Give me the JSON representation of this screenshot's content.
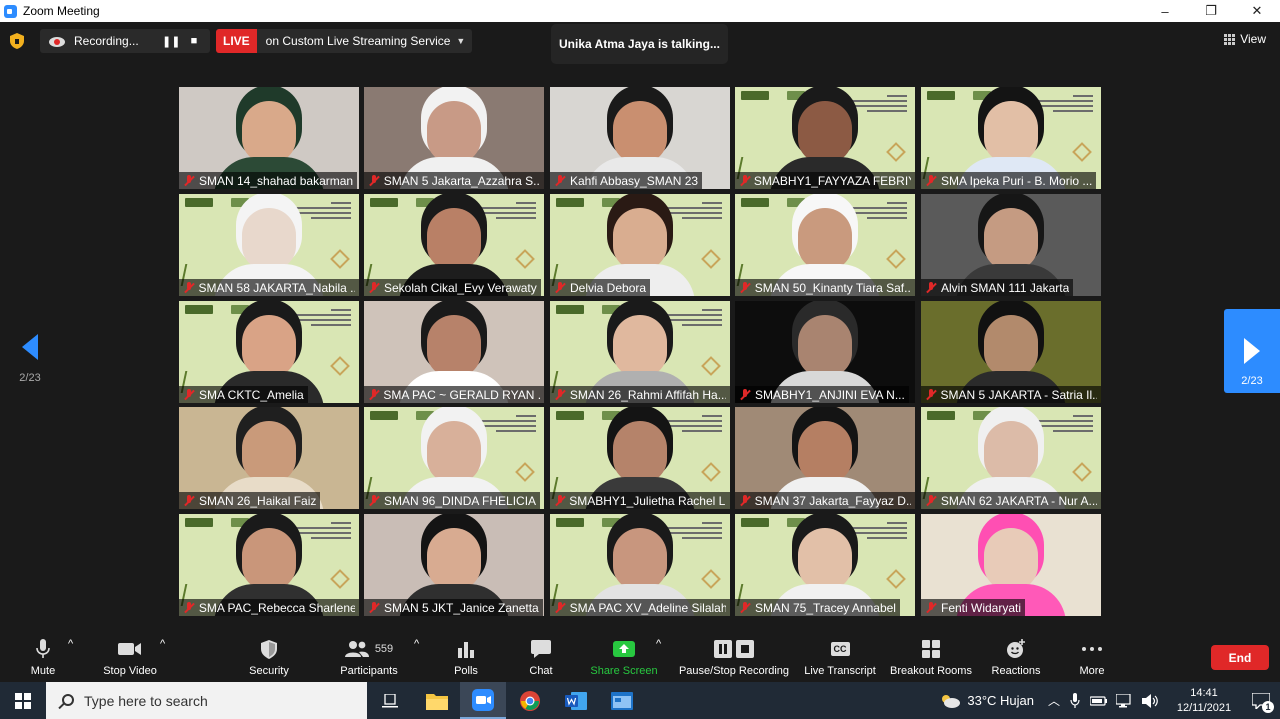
{
  "window": {
    "title": "Zoom Meeting",
    "minimize": "–",
    "maximize": "❐",
    "close": "✕"
  },
  "topbar": {
    "recording": "Recording...",
    "pause": "❚❚",
    "stop": "■",
    "live_badge": "LIVE",
    "live_service": "on Custom Live Streaming Service",
    "caret": "▼",
    "talking": "Unika Atma Jaya is talking...",
    "view": "View"
  },
  "pager": {
    "left_page": "2/23",
    "right_page": "2/23"
  },
  "participants": [
    {
      "name": "SMAN 14_shahad bakarman",
      "kind": "room",
      "bg": "#cfc9c4",
      "skin": "#d9a98a",
      "hair": "#1f3a2a",
      "shirt": "#2c4a36"
    },
    {
      "name": "SMAN 5 Jakarta_Azzahra S...",
      "kind": "room",
      "bg": "#8a7a72",
      "skin": "#c89a86",
      "hair": "#f2f2f2",
      "shirt": "#f0f0f0"
    },
    {
      "name": "Kahfi Abbasy_SMAN 23",
      "kind": "room",
      "bg": "#d8d6d2",
      "skin": "#c98f70",
      "hair": "#1a1a1a",
      "shirt": "#e9e9e9"
    },
    {
      "name": "SMABHY1_FAYYAZA FEBRIY...",
      "kind": "poster",
      "skin": "#8c5a44",
      "hair": "#1a1a1a",
      "shirt": "#2a2a2a"
    },
    {
      "name": "SMA Ipeka Puri - B. Morio ...",
      "kind": "poster",
      "skin": "#e2bfa6",
      "hair": "#141414",
      "shirt": "#dfe8f5"
    },
    {
      "name": "SMAN 58 JAKARTA_Nabila ...",
      "kind": "poster",
      "skin": "#e8d8cc",
      "hair": "#f4f4f4",
      "shirt": "#f4f4f4"
    },
    {
      "name": "Sekolah Cikal_Evy Verawaty",
      "kind": "poster",
      "skin": "#b98066",
      "hair": "#1a1a1a",
      "shirt": "#1d1d1d"
    },
    {
      "name": "Delvia Debora",
      "kind": "poster",
      "skin": "#d9ad90",
      "hair": "#2a1a14",
      "shirt": "#eeeeee"
    },
    {
      "name": "SMAN 50_Kinanty Tiara Saf...",
      "kind": "poster",
      "skin": "#c99a7e",
      "hair": "#f7f7f7",
      "shirt": "#f7f7f7"
    },
    {
      "name": "Alvin SMAN 111 Jakarta",
      "kind": "room",
      "bg": "#5a5a5a",
      "skin": "#c59b82",
      "hair": "#161616",
      "shirt": "#3a3a3a"
    },
    {
      "name": "SMA CKTC_Amelia",
      "kind": "poster",
      "skin": "#d9a386",
      "hair": "#1a1a1a",
      "shirt": "#2a2a2a"
    },
    {
      "name": "SMA PAC ~ GERALD RYAN ...",
      "kind": "room",
      "bg": "#cfc3ba",
      "skin": "#b7826a",
      "hair": "#1a1a1a",
      "shirt": "#ffffff"
    },
    {
      "name": "SMAN 26_Rahmi Affifah Ha...",
      "kind": "poster",
      "skin": "#e0b89e",
      "hair": "#1a1a1a",
      "shirt": "#b0b0b0"
    },
    {
      "name": "SMABHY1_ANJINI EVA N...",
      "kind": "room",
      "bg": "#0d0d0d",
      "skin": "#a98470",
      "hair": "#2a2a2a",
      "shirt": "#d8d8d8"
    },
    {
      "name": "SMAN 5 JAKARTA - Satria Il...",
      "kind": "room",
      "bg": "#6a6e2c",
      "skin": "#b28a6c",
      "hair": "#111111",
      "shirt": "#2b2b2b"
    },
    {
      "name": "SMAN 26_Haikal Faiz",
      "kind": "room",
      "bg": "#c9b693",
      "skin": "#c99a7a",
      "hair": "#1f1f1f",
      "shirt": "#e8dcc8"
    },
    {
      "name": "SMAN 96_DINDA FHELICIA",
      "kind": "poster",
      "skin": "#d8b09a",
      "hair": "#f2f2f2",
      "shirt": "#f2f2f2"
    },
    {
      "name": "SMABHY1_Julietha Rachel L...",
      "kind": "poster",
      "skin": "#b5836a",
      "hair": "#141414",
      "shirt": "#3a3a3a"
    },
    {
      "name": "SMAN 37 Jakarta_Fayyaz D...",
      "kind": "room",
      "bg": "#a08a76",
      "skin": "#b57f63",
      "hair": "#141414",
      "shirt": "#f0f0f0"
    },
    {
      "name": "SMAN 62 JAKARTA - Nur A...",
      "kind": "poster",
      "skin": "#dcbba8",
      "hair": "#f0f0f0",
      "shirt": "#f0f0f0"
    },
    {
      "name": "SMA PAC_Rebecca Sharlene",
      "kind": "poster",
      "skin": "#c9967a",
      "hair": "#1a1a1a",
      "shirt": "#303030"
    },
    {
      "name": "SMAN 5 JKT_Janice Zanetta",
      "kind": "room",
      "bg": "#c9bdb6",
      "skin": "#d8ab91",
      "hair": "#141414",
      "shirt": "#2f2f2f"
    },
    {
      "name": "SMA PAC XV_Adeline Silalahi",
      "kind": "poster",
      "skin": "#c8967e",
      "hair": "#1a1a1a",
      "shirt": "#e3e3e3"
    },
    {
      "name": "SMAN 75_Tracey Annabel",
      "kind": "poster",
      "skin": "#e2c0a8",
      "hair": "#1a1a1a",
      "shirt": "#f1f1f1"
    },
    {
      "name": "Fenti Widaryati",
      "kind": "room",
      "bg": "#e9e1d2",
      "skin": "#e8cbb8",
      "hair": "#ff4fb3",
      "shirt": "#ff59b8"
    }
  ],
  "toolbar": {
    "mute": "Mute",
    "stop_video": "Stop Video",
    "security": "Security",
    "participants": "Participants",
    "participants_count": "559",
    "polls": "Polls",
    "chat": "Chat",
    "share_screen": "Share Screen",
    "pause_stop_recording": "Pause/Stop Recording",
    "live_transcript": "Live Transcript",
    "breakout_rooms": "Breakout Rooms",
    "reactions": "Reactions",
    "more": "More",
    "end": "End",
    "caret": "^",
    "cc": "CC"
  },
  "taskbar": {
    "search_placeholder": "Type here to search",
    "weather": "33°C  Hujan",
    "time": "14:41",
    "date": "12/11/2021",
    "notifications": "1"
  },
  "colors": {
    "accent": "#2d8cff",
    "danger": "#e02828",
    "share_green": "#28c840"
  }
}
